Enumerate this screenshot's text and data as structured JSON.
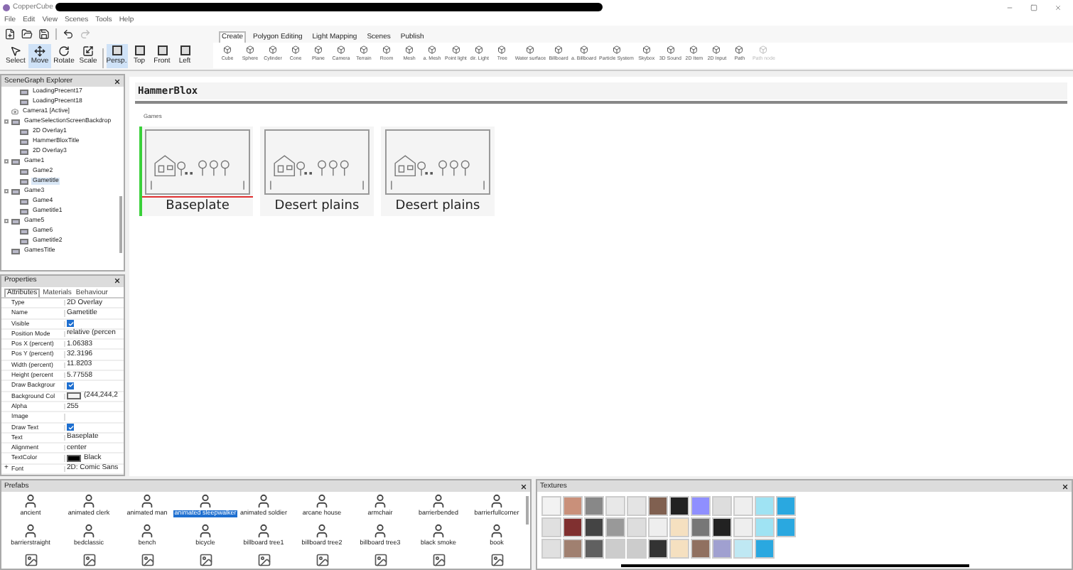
{
  "window": {
    "title": "CopperCube"
  },
  "menu": [
    "File",
    "Edit",
    "View",
    "Scenes",
    "Tools",
    "Help"
  ],
  "tools": [
    {
      "label": "Select",
      "selected": false
    },
    {
      "label": "Move",
      "selected": true
    },
    {
      "label": "Rotate",
      "selected": false
    },
    {
      "label": "Scale",
      "selected": false
    }
  ],
  "views": [
    {
      "label": "Persp.",
      "selected": true
    },
    {
      "label": "Top",
      "selected": false
    },
    {
      "label": "Front",
      "selected": false
    },
    {
      "label": "Left",
      "selected": false
    }
  ],
  "ribbon_tabs": [
    {
      "label": "Create",
      "selected": true
    },
    {
      "label": "Polygon Editing",
      "selected": false
    },
    {
      "label": "Light Mapping",
      "selected": false
    },
    {
      "label": "Scenes",
      "selected": false
    },
    {
      "label": "Publish",
      "selected": false
    }
  ],
  "create_items": [
    {
      "label": "Cube",
      "disabled": false
    },
    {
      "label": "Sphere",
      "disabled": false
    },
    {
      "label": "Cylinder",
      "disabled": false
    },
    {
      "label": "Cone",
      "disabled": false
    },
    {
      "label": "Plane",
      "disabled": false
    },
    {
      "label": "Camera",
      "disabled": false
    },
    {
      "label": "Terrain",
      "disabled": false
    },
    {
      "label": "Room",
      "disabled": false
    },
    {
      "label": "Mesh",
      "disabled": false
    },
    {
      "label": "a. Mesh",
      "disabled": false
    },
    {
      "label": "Point light",
      "disabled": false
    },
    {
      "label": "dir. Light",
      "disabled": false
    },
    {
      "label": "Tree",
      "disabled": false
    },
    {
      "label": "Water surface",
      "disabled": false
    },
    {
      "label": "Billboard",
      "disabled": false
    },
    {
      "label": "a. Billboard",
      "disabled": false
    },
    {
      "label": "Particle System",
      "disabled": false
    },
    {
      "label": "Skybox",
      "disabled": false
    },
    {
      "label": "3D Sound",
      "disabled": false
    },
    {
      "label": "2D Item",
      "disabled": false
    },
    {
      "label": "2D Input",
      "disabled": false
    },
    {
      "label": "Path",
      "disabled": false
    },
    {
      "label": "Path node",
      "disabled": true
    }
  ],
  "scenegraph": {
    "title": "SceneGraph Explorer",
    "items": [
      {
        "children": [
          {
            "label": "LoadingPrecent17",
            "kind": "overlay",
            "selected": false
          },
          {
            "label": "LoadingPrecent18",
            "kind": "overlay",
            "selected": false
          }
        ]
      },
      {
        "label": "Camera1 [Active]",
        "kind": "camera",
        "selected": false
      },
      {
        "label": "GameSelectionScreenBackdrop",
        "kind": "overlay",
        "selected": false,
        "children": [
          {
            "label": "2D Overlay1",
            "kind": "overlay",
            "selected": false
          },
          {
            "label": "HammerBloxTitle",
            "kind": "overlay",
            "selected": false
          },
          {
            "label": "2D Overlay3",
            "kind": "overlay",
            "selected": false
          }
        ]
      },
      {
        "label": "Game1",
        "kind": "overlay",
        "selected": false,
        "children": [
          {
            "label": "Game2",
            "kind": "overlay",
            "selected": false
          },
          {
            "label": "Gametitle",
            "kind": "overlay",
            "selected": true
          }
        ]
      },
      {
        "label": "Game3",
        "kind": "overlay",
        "selected": false,
        "children": [
          {
            "label": "Game4",
            "kind": "overlay",
            "selected": false
          },
          {
            "label": "Gametitle1",
            "kind": "overlay",
            "selected": false
          }
        ]
      },
      {
        "label": "Game5",
        "kind": "overlay",
        "selected": false,
        "children": [
          {
            "label": "Game6",
            "kind": "overlay",
            "selected": false
          },
          {
            "label": "Gametitle2",
            "kind": "overlay",
            "selected": false
          }
        ]
      },
      {
        "label": "GamesTitle",
        "kind": "overlay",
        "selected": false
      }
    ]
  },
  "properties": {
    "title": "Properties",
    "tabs": [
      {
        "label": "Attributes",
        "selected": true
      },
      {
        "label": "Materials",
        "selected": false
      },
      {
        "label": "Behaviour",
        "selected": false
      }
    ],
    "rows": [
      {
        "name": "Type",
        "kind": "text",
        "value": "2D Overlay"
      },
      {
        "name": "Name",
        "kind": "text",
        "value": "Gametitle"
      },
      {
        "name": "Visible",
        "kind": "check",
        "checked": true
      },
      {
        "name": "Position Mode",
        "kind": "text",
        "value": "relative (percen"
      },
      {
        "name": "Pos X (percent)",
        "kind": "text",
        "value": "1.06383"
      },
      {
        "name": "Pos Y (percent)",
        "kind": "text",
        "value": "32.3196"
      },
      {
        "name": "Width (percent)",
        "kind": "text",
        "value": "11.8203"
      },
      {
        "name": "Height (percent",
        "kind": "text",
        "value": "5.77558"
      },
      {
        "name": "Draw Backgrour",
        "kind": "check",
        "checked": true
      },
      {
        "name": "Background Col",
        "kind": "color",
        "color": "#f4f4f4",
        "value": "(244,244,2"
      },
      {
        "name": "Alpha",
        "kind": "text",
        "value": "255"
      },
      {
        "name": "Image",
        "kind": "text"
      },
      {
        "name": "Draw Text",
        "kind": "check",
        "checked": true
      },
      {
        "name": "Text",
        "kind": "text",
        "value": "Baseplate"
      },
      {
        "name": "Alignment",
        "kind": "text",
        "value": "center"
      },
      {
        "name": "TextColor",
        "kind": "color",
        "color": "#000000",
        "value": "Black"
      },
      {
        "name": "Font",
        "kind": "text",
        "value": "2D: Comic Sans",
        "expander": "+"
      }
    ]
  },
  "canvas": {
    "title": "HammerBlox",
    "section": "Games",
    "cards": [
      {
        "label": "Baseplate",
        "selected": true
      },
      {
        "label": "Desert plains",
        "selected": false
      },
      {
        "label": "Desert plains",
        "selected": false
      }
    ]
  },
  "prefabs": {
    "title": "Prefabs",
    "items": [
      {
        "label": "ancient",
        "selected": false
      },
      {
        "label": "animated clerk",
        "selected": false
      },
      {
        "label": "animated man",
        "selected": false
      },
      {
        "label": "animated sleepwalker",
        "selected": true
      },
      {
        "label": "animated soldier",
        "selected": false
      },
      {
        "label": "arcane house",
        "selected": false
      },
      {
        "label": "armchair",
        "selected": false
      },
      {
        "label": "barrierbended",
        "selected": false
      },
      {
        "label": "barrierfullcorner",
        "selected": false
      },
      {
        "label": "barrierstraight",
        "selected": false
      },
      {
        "label": "bedclassic",
        "selected": false
      },
      {
        "label": "bench",
        "selected": false
      },
      {
        "label": "bicycle",
        "selected": false
      },
      {
        "label": "billboard tree1",
        "selected": false
      },
      {
        "label": "billboard tree2",
        "selected": false
      },
      {
        "label": "billboard tree3",
        "selected": false
      },
      {
        "label": "black smoke",
        "selected": false
      },
      {
        "label": "book",
        "selected": false
      }
    ]
  },
  "textures": {
    "title": "Textures"
  }
}
